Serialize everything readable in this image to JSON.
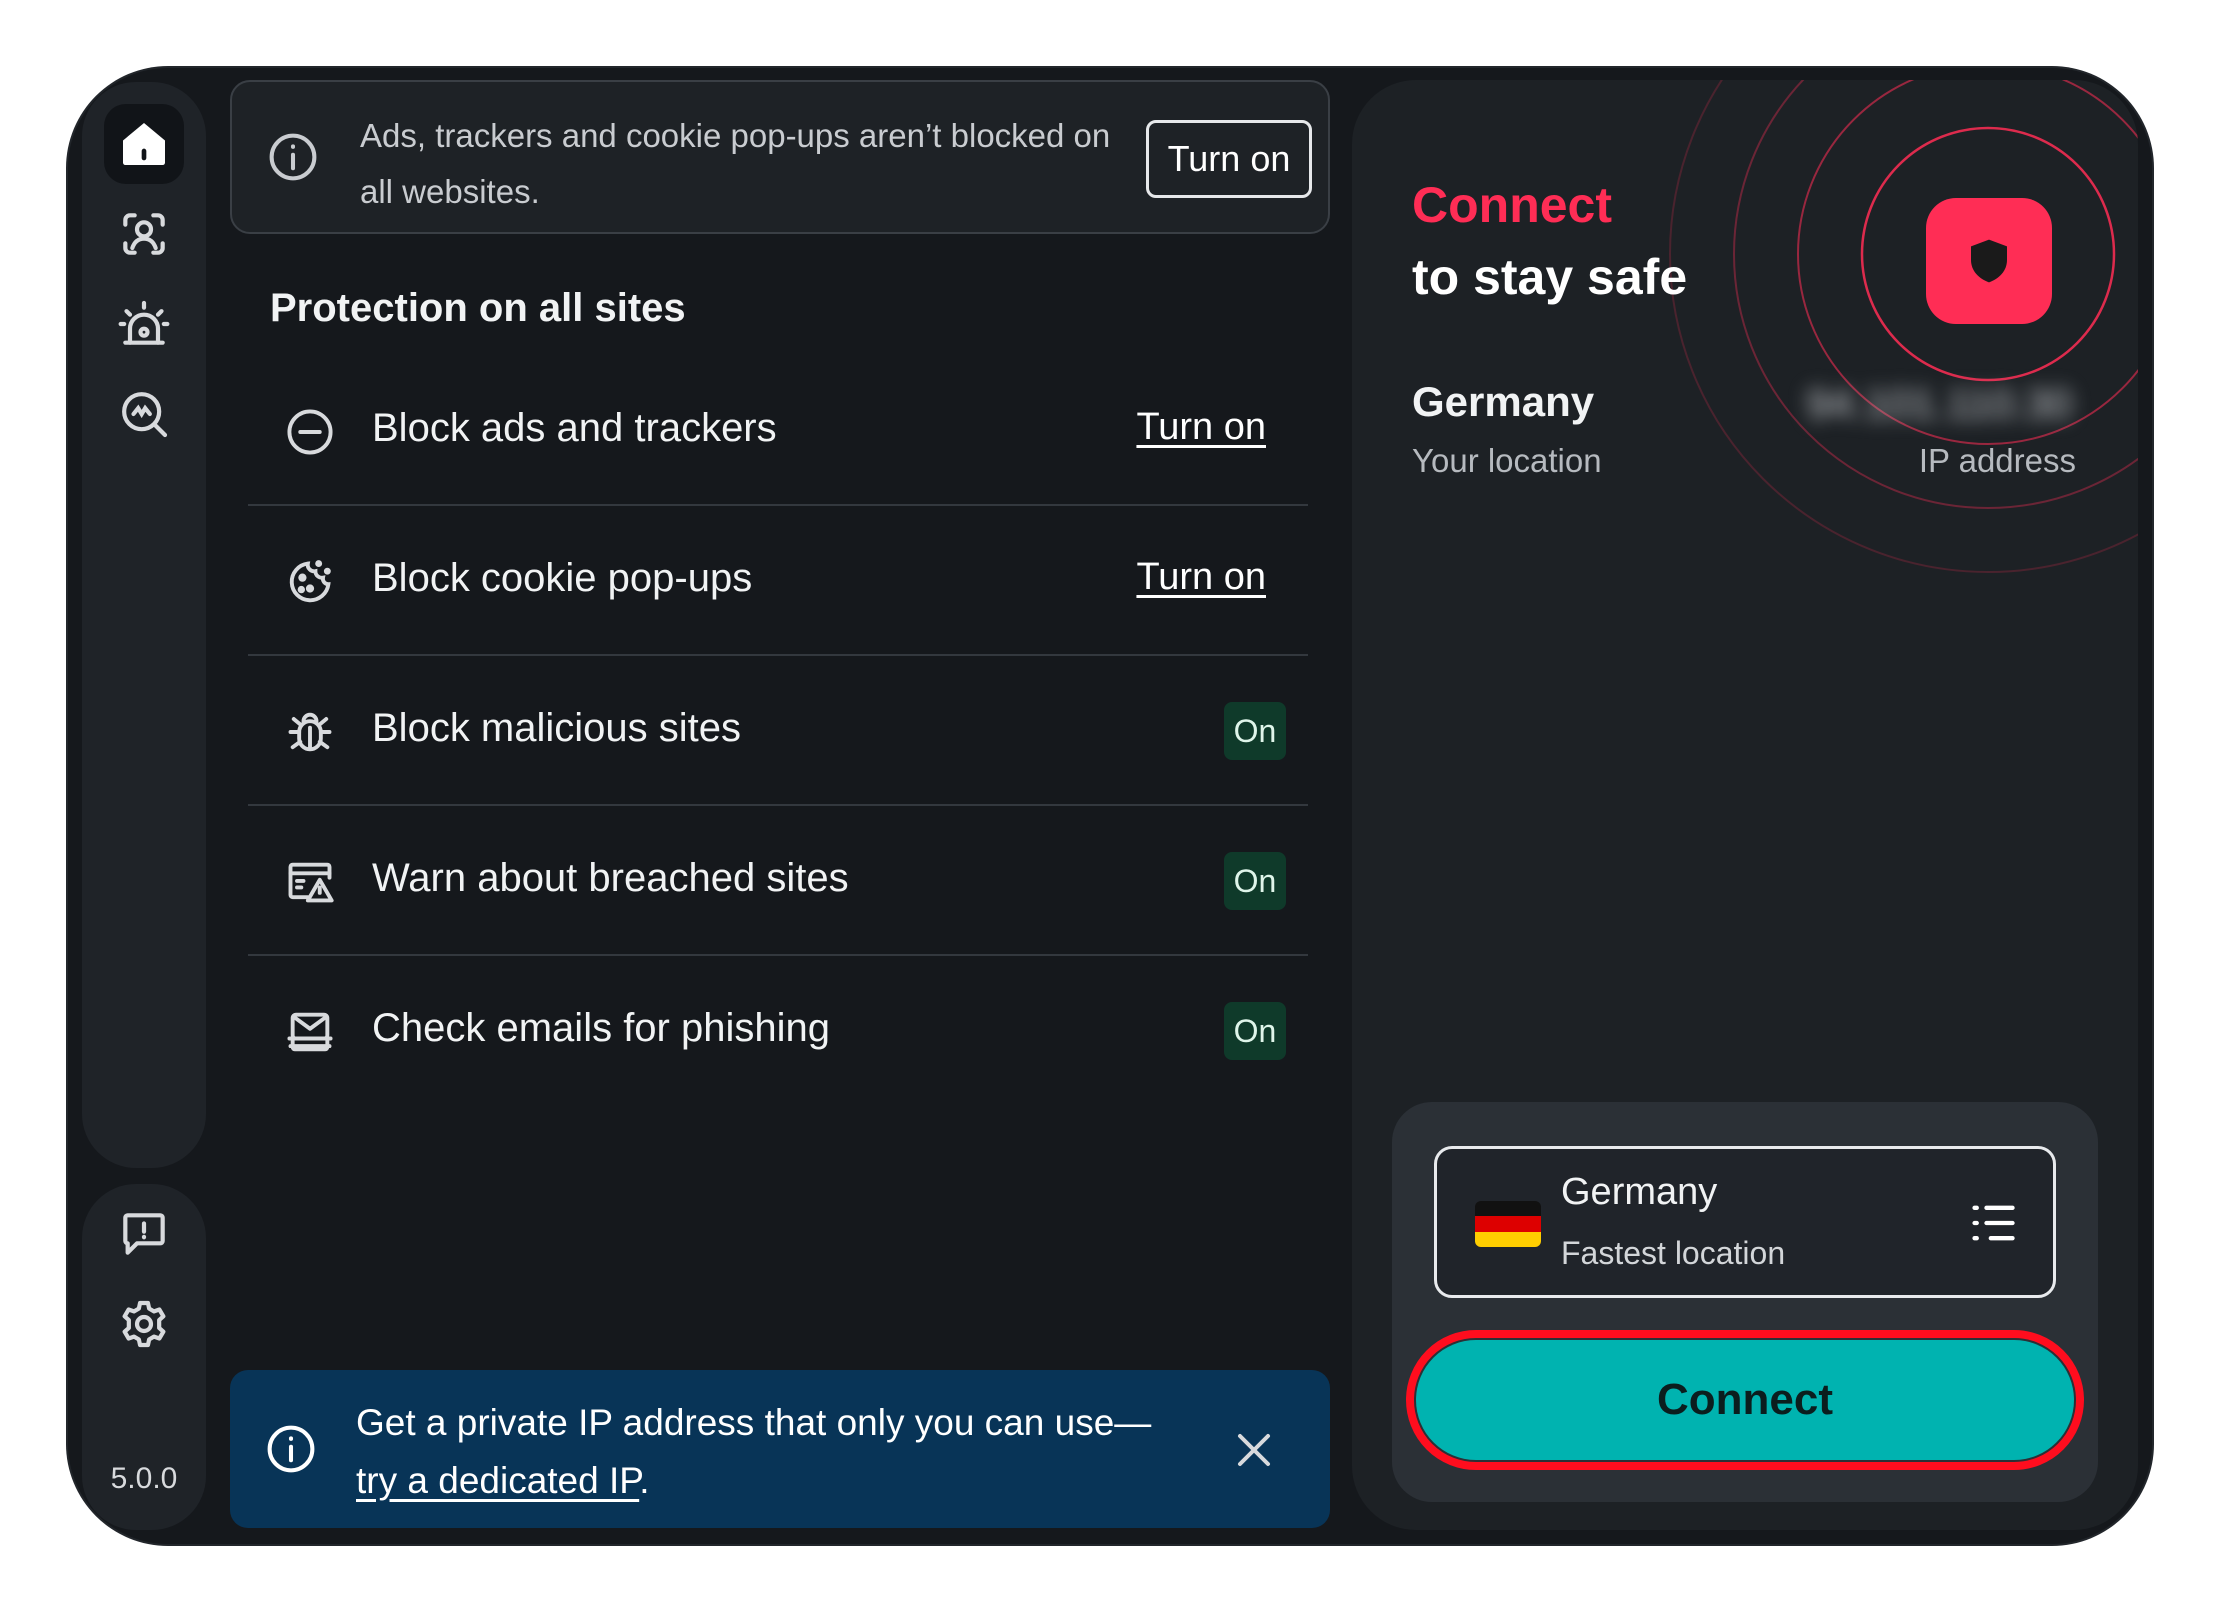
{
  "app": {
    "version": "5.0.0"
  },
  "sidebar": {
    "items": [
      {
        "id": "home",
        "icon": "home-icon"
      },
      {
        "id": "identity",
        "icon": "person-scan-icon"
      },
      {
        "id": "alerts",
        "icon": "alarm-icon"
      },
      {
        "id": "scan",
        "icon": "search-scan-icon"
      }
    ],
    "bottom": [
      {
        "id": "feedback",
        "icon": "feedback-icon"
      },
      {
        "id": "settings",
        "icon": "gear-icon"
      }
    ]
  },
  "top_banner": {
    "message": "Ads, trackers and cookie pop-ups aren’t blocked on all websites.",
    "button": "Turn on"
  },
  "protection": {
    "title": "Protection on all sites",
    "features": [
      {
        "label": "Block ads and trackers",
        "action": "Turn on",
        "icon": "minus-circle-icon"
      },
      {
        "label": "Block cookie pop-ups",
        "action": "Turn on",
        "icon": "cookie-icon"
      },
      {
        "label": "Block malicious sites",
        "status": "On",
        "icon": "bug-icon"
      },
      {
        "label": "Warn about breached sites",
        "status": "On",
        "icon": "breach-warning-icon"
      },
      {
        "label": "Check emails for phishing",
        "status": "On",
        "icon": "email-check-icon"
      }
    ]
  },
  "bottom_banner": {
    "text": "Get a private IP address that only you can use—",
    "link": "try a dedicated IP",
    "suffix": "."
  },
  "vpn": {
    "title": "Connect",
    "subtitle": "to stay safe",
    "location": "Germany",
    "location_label": "Your location",
    "ip": "94.101.110.30",
    "ip_label": "IP address",
    "selector": {
      "country": "Germany",
      "subtitle": "Fastest location"
    },
    "connect_button": "Connect",
    "colors": {
      "accent": "#ff2d55",
      "connect": "#00b3b0",
      "badge_bg": "#0f3a2a"
    }
  }
}
